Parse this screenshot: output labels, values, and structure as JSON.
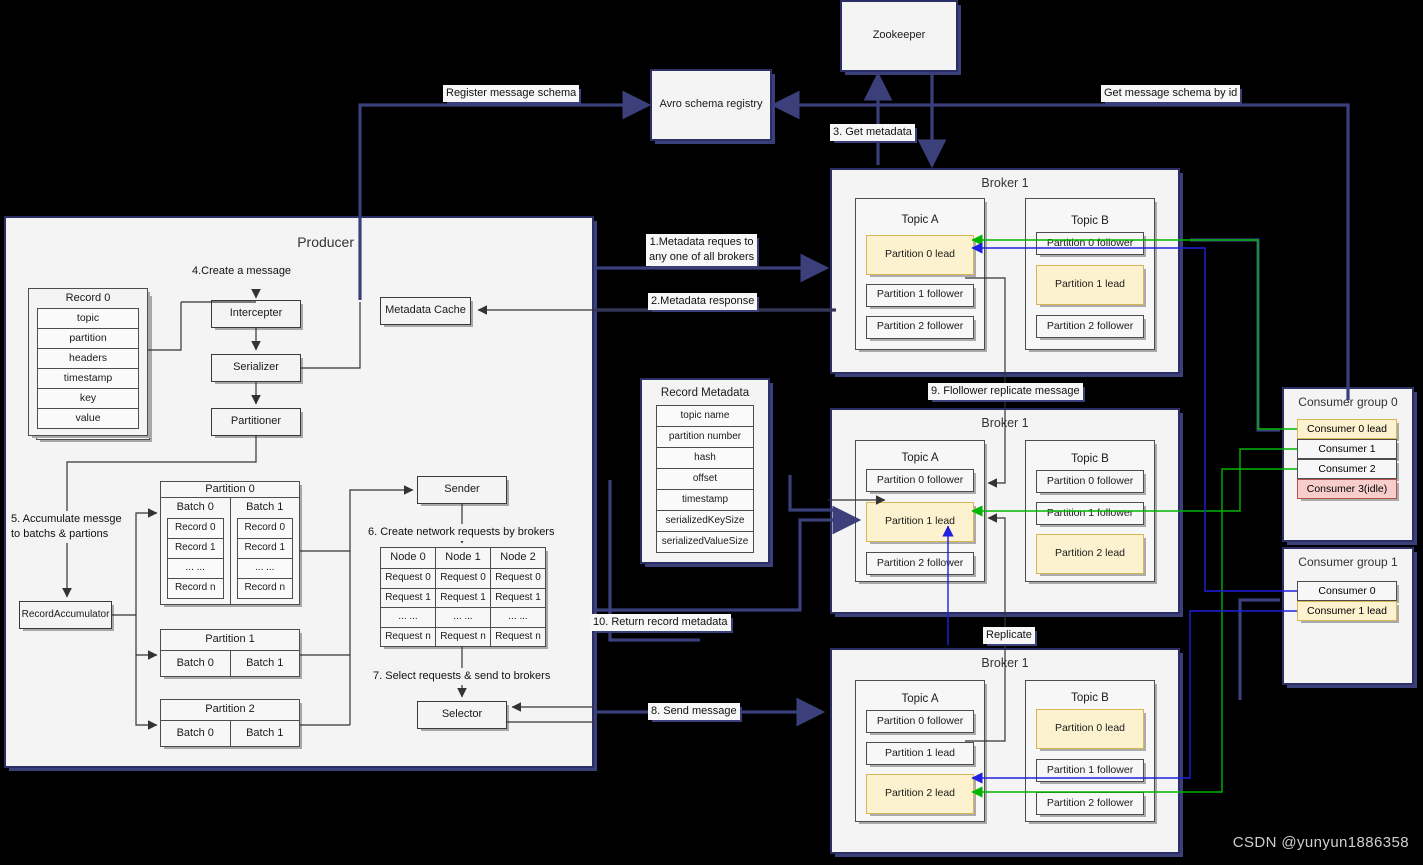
{
  "meta": {
    "watermark": "CSDN @yunyun1886358",
    "colors": {
      "lead_fill": "#fdf2cf",
      "lead_border": "#d6b656",
      "idle_fill": "#f8cecc",
      "idle_border": "#b85450",
      "navy_edge": "#3b3f7a",
      "green_edge": "#00b500",
      "blue_edge": "#2020e0",
      "panel_fill": "#f4f4f4"
    }
  },
  "zookeeper": {
    "title": "Zookeeper"
  },
  "schema_registry": {
    "title": "Avro schema registry"
  },
  "producer": {
    "title": "Producer",
    "record": {
      "title": "Record 0",
      "fields": [
        "topic",
        "partition",
        "headers",
        "timestamp",
        "key",
        "value"
      ]
    },
    "pipeline": [
      "Intercepter",
      "Serializer",
      "Partitioner"
    ],
    "metadata_cache": "Metadata Cache",
    "record_accumulator": "RecordAccumulator",
    "sender": "Sender",
    "selector": "Selector",
    "partitions": [
      {
        "title": "Partition 0",
        "batches": [
          {
            "title": "Batch 0",
            "records": [
              "Record 0",
              "Record 1",
              "... ...",
              "Record n"
            ]
          },
          {
            "title": "Batch 1",
            "records": [
              "Record 0",
              "Record 1",
              "... ...",
              "Record n"
            ]
          }
        ]
      },
      {
        "title": "Partition 1",
        "batches": [
          {
            "title": "Batch 0"
          },
          {
            "title": "Batch 1"
          }
        ]
      },
      {
        "title": "Partition 2",
        "batches": [
          {
            "title": "Batch 0"
          },
          {
            "title": "Batch 1"
          }
        ]
      }
    ],
    "node_table": {
      "headers": [
        "Node 0",
        "Node 1",
        "Node 2"
      ],
      "rows": [
        [
          "Request 0",
          "Request 0",
          "Request 0"
        ],
        [
          "Request 1",
          "Request 1",
          "Request 1"
        ],
        [
          "... ...",
          "... ...",
          "... ..."
        ],
        [
          "Request n",
          "Request n",
          "Request n"
        ]
      ]
    }
  },
  "record_metadata": {
    "title": "Record Metadata",
    "fields": [
      "topic name",
      "partition number",
      "hash",
      "offset",
      "timestamp",
      "serializedKeySize",
      "serializedValueSize"
    ]
  },
  "brokers": [
    {
      "title": "Broker 1",
      "topics": [
        {
          "title": "Topic A",
          "partitions": [
            {
              "label": "Partition 0 lead",
              "role": "lead"
            },
            {
              "label": "Partition 1 follower",
              "role": "follower"
            },
            {
              "label": "Partition 2 follower",
              "role": "follower"
            }
          ]
        },
        {
          "title": "Topic B",
          "partitions": [
            {
              "label": "Partition 0 follower",
              "role": "follower"
            },
            {
              "label": "Partition 1 lead",
              "role": "lead"
            },
            {
              "label": "Partition 2 follower",
              "role": "follower"
            }
          ]
        }
      ]
    },
    {
      "title": "Broker 1",
      "topics": [
        {
          "title": "Topic A",
          "partitions": [
            {
              "label": "Partition 0 follower",
              "role": "follower"
            },
            {
              "label": "Partition 1 lead",
              "role": "lead"
            },
            {
              "label": "Partition 2 follower",
              "role": "follower"
            }
          ]
        },
        {
          "title": "Topic B",
          "partitions": [
            {
              "label": "Partition 0 follower",
              "role": "follower"
            },
            {
              "label": "Partition 1 follower",
              "role": "follower"
            },
            {
              "label": "Partition 2 lead",
              "role": "lead"
            }
          ]
        }
      ]
    },
    {
      "title": "Broker 1",
      "topics": [
        {
          "title": "Topic A",
          "partitions": [
            {
              "label": "Partition 0 follower",
              "role": "follower"
            },
            {
              "label": "Partition 1 lead",
              "role": "follower"
            },
            {
              "label": "Partition 2 lead",
              "role": "lead"
            }
          ]
        },
        {
          "title": "Topic B",
          "partitions": [
            {
              "label": "Partition 0 lead",
              "role": "lead"
            },
            {
              "label": "Partition 1 follower",
              "role": "follower"
            },
            {
              "label": "Partition 2 follower",
              "role": "follower"
            }
          ]
        }
      ]
    }
  ],
  "consumer_groups": [
    {
      "title": "Consumer group 0",
      "consumers": [
        {
          "label": "Consumer 0 lead",
          "state": "lead"
        },
        {
          "label": "Consumer 1",
          "state": "active"
        },
        {
          "label": "Consumer 2",
          "state": "active"
        },
        {
          "label": "Consumer 3(idle)",
          "state": "idle"
        }
      ]
    },
    {
      "title": "Consumer group 1",
      "consumers": [
        {
          "label": "Consumer 0",
          "state": "active"
        },
        {
          "label": "Consumer  1 lead",
          "state": "lead"
        }
      ]
    }
  ],
  "edge_labels": {
    "register_schema": "Register message schema",
    "get_schema_by_id": "Get message schema by id",
    "get_metadata": "3. Get metadata",
    "metadata_request": "1.Metadata reques to\nany one of all brokers",
    "metadata_response": "2.Metadata response",
    "create_message": "4.Create a message",
    "accumulate": "5. Accumulate messge\nto batchs & partions",
    "create_requests": "6. Create network requests by brokers",
    "select_requests": "7. Select requests & send to brokers",
    "send_message": "8. Send message",
    "follower_replicate": "9. Flollower replicate message",
    "return_metadata": "10. Return record metadata",
    "replicate": "Replicate"
  }
}
